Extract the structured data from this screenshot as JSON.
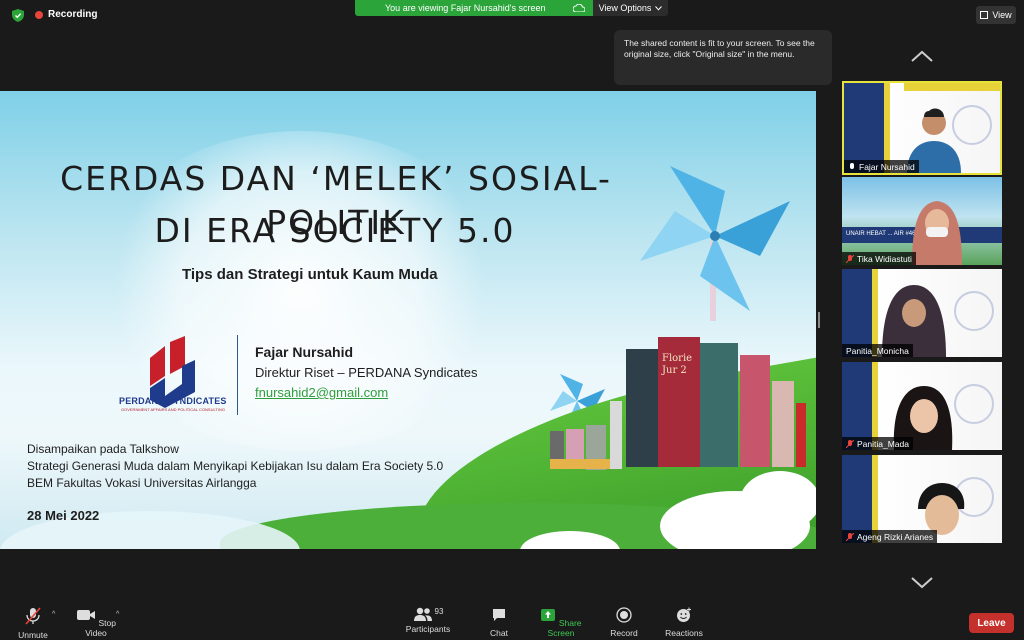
{
  "topbar": {
    "recording_label": "Recording",
    "banner_text": "You are viewing Fajar Nursahid's screen",
    "view_options_label": "View Options",
    "view_label": "View"
  },
  "tooltip": {
    "text": "The shared content is fit to your screen. To see the original size, click \"Original size\" in the menu."
  },
  "slide": {
    "title_line1": "CERDAS DAN ‘MELEK’ SOSIAL-POLITIK",
    "title_line2": "DI ERA SOCIETY 5.0",
    "subtitle": "Tips dan Strategi untuk Kaum Muda",
    "logo_name": "PERDANA SYNDICATES",
    "logo_tagline": "GOVERNMENT AFFAIRS AND POLITICAL CONSULTING",
    "presenter_name": "Fajar Nursahid",
    "presenter_role": "Direktur Riset – PERDANA Syndicates",
    "presenter_email": "fnursahid2@gmail.com",
    "talk_line1": "Disampaikan pada Talkshow",
    "talk_line2": "Strategi Generasi Muda dalam Menyikapi Kebijakan Isu dalam Era Society 5.0",
    "talk_line3": "BEM Fakultas Vokasi Universitas Airlangga",
    "date": "28 Mei 2022",
    "book_text": "Florie Jur 2"
  },
  "participants_panel": [
    {
      "name": "Fajar Nursahid",
      "active": true,
      "muted": false
    },
    {
      "name": "Tika Widiastuti",
      "active": false,
      "muted": true
    },
    {
      "name": "Panitia_Monicha",
      "active": false,
      "muted": false
    },
    {
      "name": "Panitia_Mada",
      "active": false,
      "muted": true
    },
    {
      "name": "Ageng Rizki Arianes",
      "active": false,
      "muted": true
    }
  ],
  "thumb_banner": "UNAIR HEBAT ... AIR #465",
  "toolbar": {
    "unmute_label": "Unmute",
    "stop_video_label": "Stop Video",
    "participants_label": "Participants",
    "participants_count": "93",
    "chat_label": "Chat",
    "share_screen_label": "Share Screen",
    "record_label": "Record",
    "reactions_label": "Reactions",
    "leave_label": "Leave"
  },
  "colors": {
    "share_green": "#2ba43a",
    "leave_red": "#c4302b",
    "active_border": "#e8e33a",
    "record_red": "#e8453c"
  }
}
